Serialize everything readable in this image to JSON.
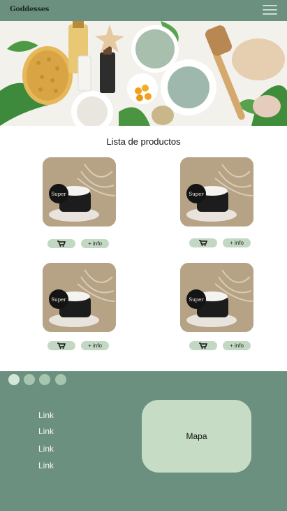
{
  "header": {
    "logo_text": "Goddesses",
    "menu_icon": "hamburger-menu-icon",
    "background_color": "#6b9080"
  },
  "hero": {
    "icon": "spa-products-photo"
  },
  "products": {
    "title": "Lista de productos",
    "items": [
      {
        "image_label": "Super",
        "cart_icon": "cart-icon",
        "info_label": "+ info"
      },
      {
        "image_label": "Super",
        "cart_icon": "cart-icon",
        "info_label": "+ info"
      },
      {
        "image_label": "Super",
        "cart_icon": "cart-icon",
        "info_label": "+ info"
      },
      {
        "image_label": "Super",
        "cart_icon": "cart-icon",
        "info_label": "+ info"
      }
    ],
    "button_color": "#c2d8c3"
  },
  "footer": {
    "background_color": "#6b9080",
    "carousel_dots": 4,
    "links": [
      "Link",
      "Link",
      "Link",
      "Link"
    ],
    "map_label": "Mapa"
  }
}
